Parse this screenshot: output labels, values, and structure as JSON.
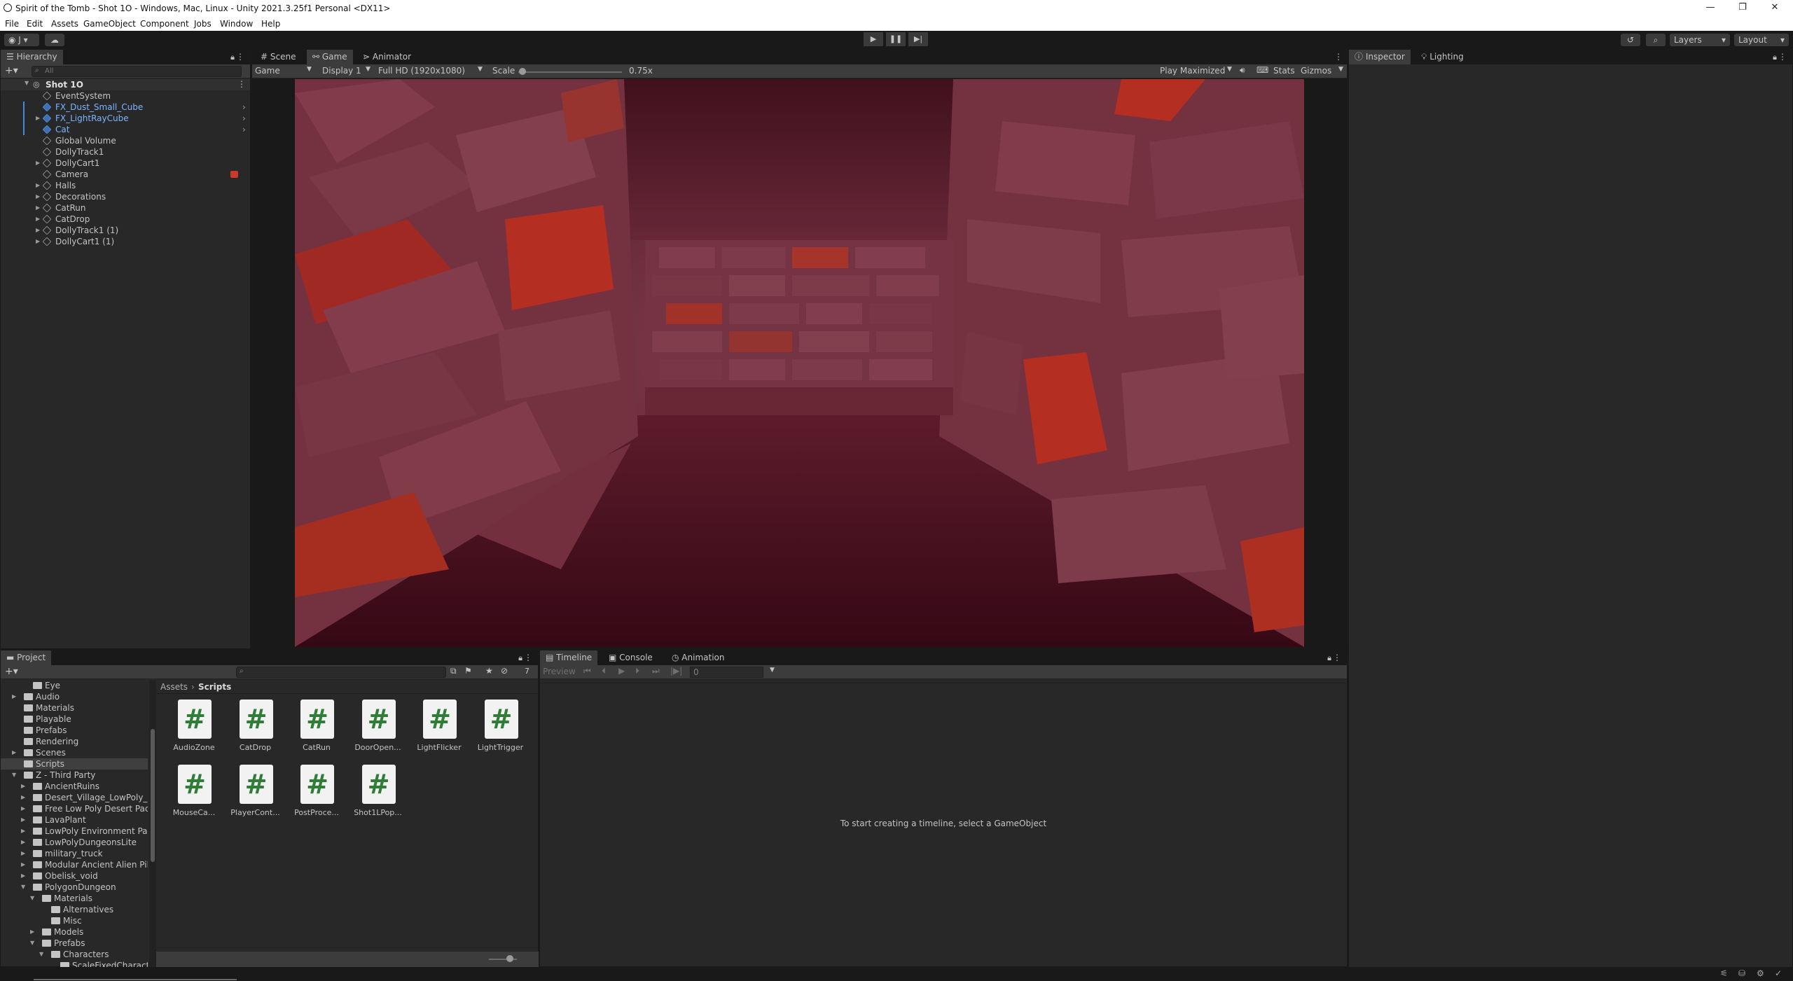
{
  "window": {
    "title": "Spirit of the Tomb - Shot 1O - Windows, Mac, Linux - Unity 2021.3.25f1 Personal <DX11>",
    "minimize": "—",
    "restore": "❐",
    "close": "✕"
  },
  "menu": [
    "File",
    "Edit",
    "Assets",
    "GameObject",
    "Component",
    "Jobs",
    "Window",
    "Help"
  ],
  "toolbar": {
    "account": "J",
    "layers": "Layers",
    "layout": "Layout"
  },
  "hierarchy": {
    "tab": "Hierarchy",
    "search_placeholder": "All",
    "scene": "Shot 1O",
    "items": [
      {
        "label": "EventSystem",
        "depth": 1,
        "expandable": false,
        "prefab": false
      },
      {
        "label": "FX_Dust_Small_Cube",
        "depth": 1,
        "expandable": false,
        "prefab": true
      },
      {
        "label": "FX_LightRayCube",
        "depth": 1,
        "expandable": true,
        "prefab": true
      },
      {
        "label": "Cat",
        "depth": 1,
        "expandable": false,
        "prefab": true
      },
      {
        "label": "Global Volume",
        "depth": 1,
        "expandable": false,
        "prefab": false
      },
      {
        "label": "DollyTrack1",
        "depth": 1,
        "expandable": false,
        "prefab": false
      },
      {
        "label": "DollyCart1",
        "depth": 1,
        "expandable": true,
        "prefab": false
      },
      {
        "label": "Camera",
        "depth": 1,
        "expandable": false,
        "prefab": false
      },
      {
        "label": "Halls",
        "depth": 1,
        "expandable": true,
        "prefab": false
      },
      {
        "label": "Decorations",
        "depth": 1,
        "expandable": true,
        "prefab": false
      },
      {
        "label": "CatRun",
        "depth": 1,
        "expandable": true,
        "prefab": false
      },
      {
        "label": "CatDrop",
        "depth": 1,
        "expandable": true,
        "prefab": false
      },
      {
        "label": "DollyTrack1 (1)",
        "depth": 1,
        "expandable": true,
        "prefab": false
      },
      {
        "label": "DollyCart1 (1)",
        "depth": 1,
        "expandable": true,
        "prefab": false
      }
    ]
  },
  "game_view": {
    "tabs": [
      "Scene",
      "Game",
      "Animator"
    ],
    "active_tab": "Game",
    "mode": "Game",
    "display": "Display 1",
    "resolution": "Full HD (1920x1080)",
    "scale_label": "Scale",
    "scale_value": "0.75x",
    "play_mode": "Play Maximized",
    "stats": "Stats",
    "gizmos": "Gizmos",
    "wall_color": "#7a3645",
    "fog_color": "#5a1b2c",
    "accent_red": "#c8341f"
  },
  "inspector": {
    "tabs": [
      "Inspector",
      "Lighting"
    ]
  },
  "project": {
    "tab": "Project",
    "hidden_count": "7",
    "tree": [
      {
        "label": "Eye",
        "indent": 2,
        "arrow": ""
      },
      {
        "label": "Audio",
        "indent": 1,
        "arrow": "▶"
      },
      {
        "label": "Materials",
        "indent": 1,
        "arrow": ""
      },
      {
        "label": "Playable",
        "indent": 1,
        "arrow": ""
      },
      {
        "label": "Prefabs",
        "indent": 1,
        "arrow": ""
      },
      {
        "label": "Rendering",
        "indent": 1,
        "arrow": ""
      },
      {
        "label": "Scenes",
        "indent": 1,
        "arrow": "▶"
      },
      {
        "label": "Scripts",
        "indent": 1,
        "arrow": "",
        "selected": true
      },
      {
        "label": "Z - Third Party",
        "indent": 1,
        "arrow": "▼"
      },
      {
        "label": "AncientRuins",
        "indent": 2,
        "arrow": "▶"
      },
      {
        "label": "Desert_Village_LowPoly_H",
        "indent": 2,
        "arrow": "▶"
      },
      {
        "label": "Free Low Poly Desert Pacl",
        "indent": 2,
        "arrow": "▶"
      },
      {
        "label": "LavaPlant",
        "indent": 2,
        "arrow": "▶"
      },
      {
        "label": "LowPoly Environment Pac",
        "indent": 2,
        "arrow": "▶"
      },
      {
        "label": "LowPolyDungeonsLite",
        "indent": 2,
        "arrow": "▶"
      },
      {
        "label": "military_truck",
        "indent": 2,
        "arrow": "▶"
      },
      {
        "label": "Modular Ancient Alien Pilla",
        "indent": 2,
        "arrow": "▶"
      },
      {
        "label": "Obelisk_void",
        "indent": 2,
        "arrow": "▶"
      },
      {
        "label": "PolygonDungeon",
        "indent": 2,
        "arrow": "▼"
      },
      {
        "label": "Materials",
        "indent": 3,
        "arrow": "▼"
      },
      {
        "label": "Alternatives",
        "indent": 4,
        "arrow": ""
      },
      {
        "label": "Misc",
        "indent": 4,
        "arrow": ""
      },
      {
        "label": "Models",
        "indent": 3,
        "arrow": "▶"
      },
      {
        "label": "Prefabs",
        "indent": 3,
        "arrow": "▼"
      },
      {
        "label": "Characters",
        "indent": 4,
        "arrow": "▼"
      },
      {
        "label": "ScaleFixedCharact",
        "indent": 5,
        "arrow": ""
      }
    ],
    "breadcrumb": [
      "Assets",
      "Scripts"
    ],
    "assets": [
      "AudioZone",
      "CatDrop",
      "CatRun",
      "DoorOpen...",
      "LightFlicker",
      "LightTrigger",
      "MouseCa...",
      "PlayerCont...",
      "PostProce...",
      "Shot1LPop..."
    ]
  },
  "timeline": {
    "tabs": [
      "Timeline",
      "Console",
      "Animation"
    ],
    "preview": "Preview",
    "frame": "0",
    "empty_message": "To start creating a timeline, select a GameObject"
  }
}
